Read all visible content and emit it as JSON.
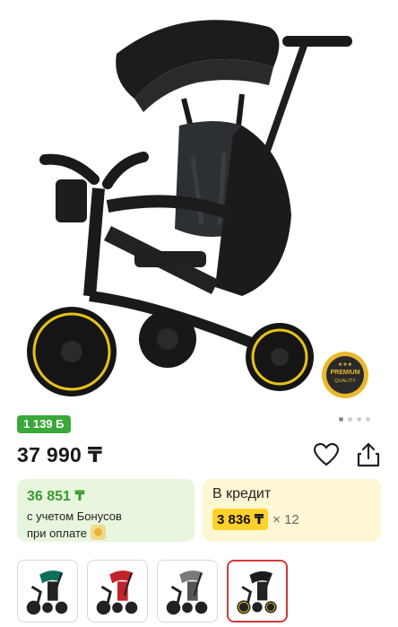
{
  "product": {
    "bonus_badge": "1 139 Б",
    "price": "37 990 ₸",
    "carousel": {
      "total": 4,
      "active": 0
    },
    "premium_badge": {
      "line1": "PREMIUM",
      "line2": "QUALITY"
    }
  },
  "bonus_card": {
    "value": "36 851 ₸",
    "line1": "с учетом Бонусов",
    "line2": "при оплате"
  },
  "credit_card": {
    "title": "В кредит",
    "value": "3 836 ₸",
    "multiplier": "× 12"
  },
  "variants": [
    {
      "color": "#0e6e5c",
      "selected": false
    },
    {
      "color": "#c2222c",
      "selected": false
    },
    {
      "color": "#7a7a7a",
      "selected": false
    },
    {
      "color": "#222222",
      "selected": true
    }
  ],
  "colors": {
    "accent_green": "#3aa83a",
    "accent_yellow": "#ffd12a",
    "wheel_rim": "#e6c21a",
    "selected_border": "#d23a3a"
  }
}
